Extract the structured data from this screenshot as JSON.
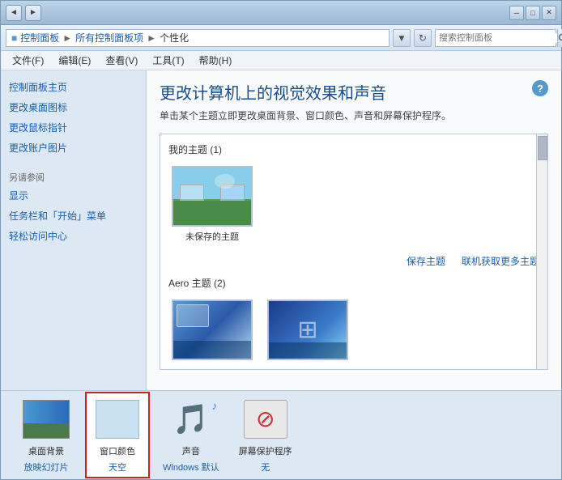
{
  "window": {
    "title": "个性化",
    "controls": {
      "minimize": "─",
      "maximize": "□",
      "close": "✕"
    }
  },
  "titlebar": {
    "nav_back": "◄",
    "nav_forward": "►"
  },
  "addressbar": {
    "icon": "■",
    "path": [
      "控制面板",
      "所有控制面板项",
      "个性化"
    ],
    "separator": "►",
    "refresh": "↻",
    "search_placeholder": "搜索控制面板"
  },
  "menubar": {
    "items": [
      "文件(F)",
      "编辑(E)",
      "查看(V)",
      "工具(T)",
      "帮助(H)"
    ]
  },
  "sidebar": {
    "main_links": [
      "控制面板主页",
      "更改桌面图标",
      "更改鼠标指针",
      "更改账户图片"
    ],
    "also_see_title": "另请参阅",
    "also_see_links": [
      "显示",
      "任务栏和「开始」菜单",
      "轻松访问中心"
    ]
  },
  "content": {
    "page_title": "更改计算机上的视觉效果和声音",
    "page_subtitle": "单击某个主题立即更改桌面背景、窗口颜色、声音和屏幕保护程序。",
    "help_icon": "?",
    "my_themes_label": "我的主题 (1)",
    "unsaved_theme_label": "未保存的主题",
    "aero_themes_label": "Aero 主题 (2)",
    "save_theme_link": "保存主题",
    "online_themes_link": "联机获取更多主题"
  },
  "toolbar": {
    "wallpaper": {
      "label": "桌面背景",
      "sublabel": "放映幻灯片"
    },
    "window_color": {
      "label": "窗口颜色",
      "sublabel": "天空"
    },
    "sound": {
      "label": "声音",
      "sublabel": "Windows 默认"
    },
    "screensaver": {
      "label": "屏幕保护程序",
      "sublabel": "无"
    }
  }
}
